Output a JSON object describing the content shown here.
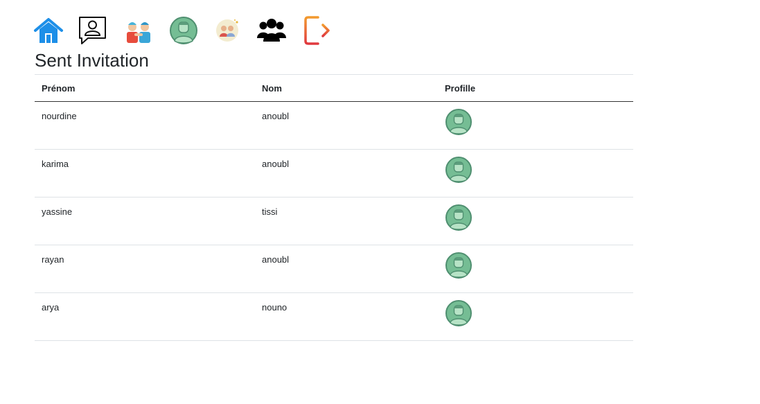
{
  "nav": {
    "items": [
      {
        "icon": "home-icon",
        "color": "#1e90ff"
      },
      {
        "icon": "contact-card-icon",
        "color": "#000000"
      },
      {
        "icon": "friends-icon",
        "color": "#e74c3c"
      },
      {
        "icon": "profile-avatar-icon",
        "color": "#74b894"
      },
      {
        "icon": "couple-icon",
        "color": "#f3ecd0"
      },
      {
        "icon": "group-icon",
        "color": "#000000"
      },
      {
        "icon": "logout-icon",
        "color": "#e8542d"
      }
    ]
  },
  "page": {
    "title": "Sent Invitation"
  },
  "table": {
    "headers": {
      "first_name": "Prénom",
      "last_name": "Nom",
      "profile": "Profille"
    },
    "rows": [
      {
        "first_name": "nourdine",
        "last_name": "anoubl",
        "avatar": "avatar-icon"
      },
      {
        "first_name": "karima",
        "last_name": "anoubl",
        "avatar": "avatar-icon"
      },
      {
        "first_name": "yassine",
        "last_name": "tissi",
        "avatar": "avatar-icon"
      },
      {
        "first_name": "rayan",
        "last_name": "anoubl",
        "avatar": "avatar-icon"
      },
      {
        "first_name": "arya",
        "last_name": "nouno",
        "avatar": "avatar-icon"
      }
    ]
  }
}
